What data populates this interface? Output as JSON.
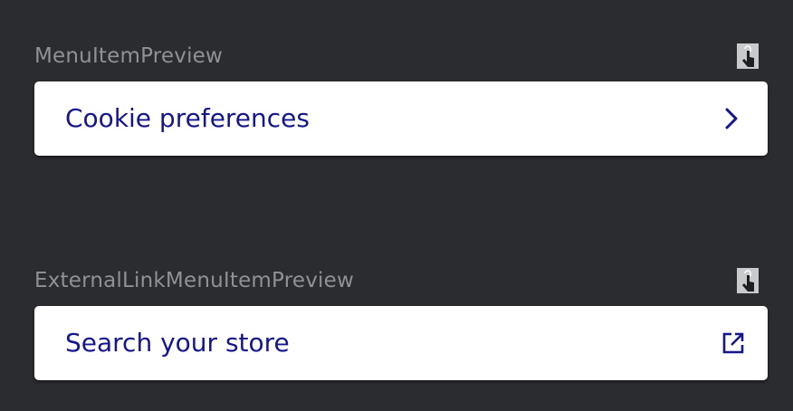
{
  "colors": {
    "background": "#2b2c2f",
    "label_text": "#8e9196",
    "card_background": "#ffffff",
    "item_text": "#16168c",
    "icon": "#16168c"
  },
  "previews": [
    {
      "label": "MenuItemPreview",
      "item": {
        "text": "Cookie preferences",
        "trailing_icon": "chevron-right-icon"
      },
      "badge_icon": "interactive-preview-icon"
    },
    {
      "label": "ExternalLinkMenuItemPreview",
      "item": {
        "text": "Search your store",
        "trailing_icon": "external-link-icon"
      },
      "badge_icon": "interactive-preview-icon"
    }
  ]
}
